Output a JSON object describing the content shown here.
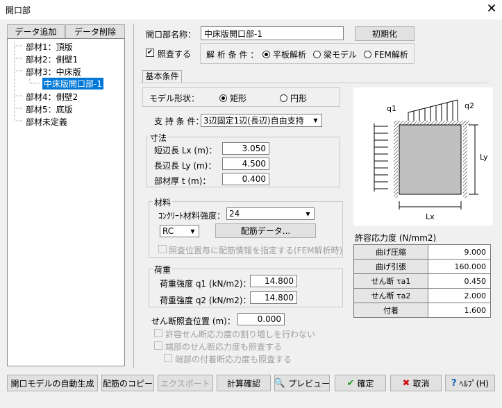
{
  "window": {
    "title": "開口部"
  },
  "tree": {
    "add_label": "データ追加",
    "delete_label": "データ削除",
    "items": [
      "部材1：頂版",
      "部材2：側壁1",
      "部材3：中床版",
      "中床版開口部-1",
      "部材4：側壁2",
      "部材5：底版",
      "部材未定義"
    ]
  },
  "form": {
    "name_label": "開口部名称：",
    "name_value": "中床版開口部-1",
    "init_label": "初期化",
    "check_label": "照査する",
    "analysis_label": "解 析 条 件 ：",
    "analysis_options": [
      "平板解析",
      "梁モデル",
      "FEM解析"
    ],
    "tab_label": "基本条件",
    "shape_label": "モデル形状：",
    "shape_options": [
      "矩形",
      "円形"
    ],
    "support_label": "支 持 条 件：",
    "support_value": "3辺固定1辺(長辺)自由支持"
  },
  "dims": {
    "group_label": "寸法",
    "short_label": "短辺長 Lx (m)：",
    "short_value": "3.050",
    "long_label": "長辺長 Ly (m)：",
    "long_value": "4.500",
    "thick_label": "部材厚 t  (m)：",
    "thick_value": "0.400"
  },
  "material": {
    "group_label": "材料",
    "concrete_label": "ｺﾝｸﾘｰﾄ材料強度：",
    "concrete_value": "24",
    "type_value": "RC",
    "rebar_label": "配筋データ...",
    "per_position_label": "照査位置毎に配筋情報を指定する(FEM解析時)"
  },
  "load": {
    "group_label": "荷重",
    "q1_label": "荷重強度 q1 (kN/m2)：",
    "q1_value": "14.800",
    "q2_label": "荷重強度 q2 (kN/m2)：",
    "q2_value": "14.800"
  },
  "shear": {
    "position_label": "せん断照査位置 (m)：",
    "position_value": "0.000",
    "opt1": "許容せん断応力度の割り増しを行わない",
    "opt2": "端部のせん断応力度も照査する",
    "opt3": "端部の付着断応力度も照査する"
  },
  "diagram": {
    "q1": "q1",
    "q2": "q2",
    "ly": "Ly",
    "lx": "Lx"
  },
  "stress": {
    "title": "許容応力度 (N/mm2)",
    "rows": [
      {
        "label": "曲げ圧縮",
        "value": "9.000"
      },
      {
        "label": "曲げ引張",
        "value": "160.000"
      },
      {
        "label": "せん断 τa1",
        "value": "0.450"
      },
      {
        "label": "せん断 τa2",
        "value": "2.000"
      },
      {
        "label": "付着",
        "value": "1.600"
      }
    ]
  },
  "bottom": {
    "auto_label": "開口モデルの自動生成",
    "copy_label": "配筋のコピー",
    "export_label": "エクスポート",
    "calc_label": "計算確認",
    "preview_label": "プレビュー",
    "ok_label": "確定",
    "cancel_label": "取消",
    "help_label": "ﾍﾙﾌﾟ(H)"
  }
}
